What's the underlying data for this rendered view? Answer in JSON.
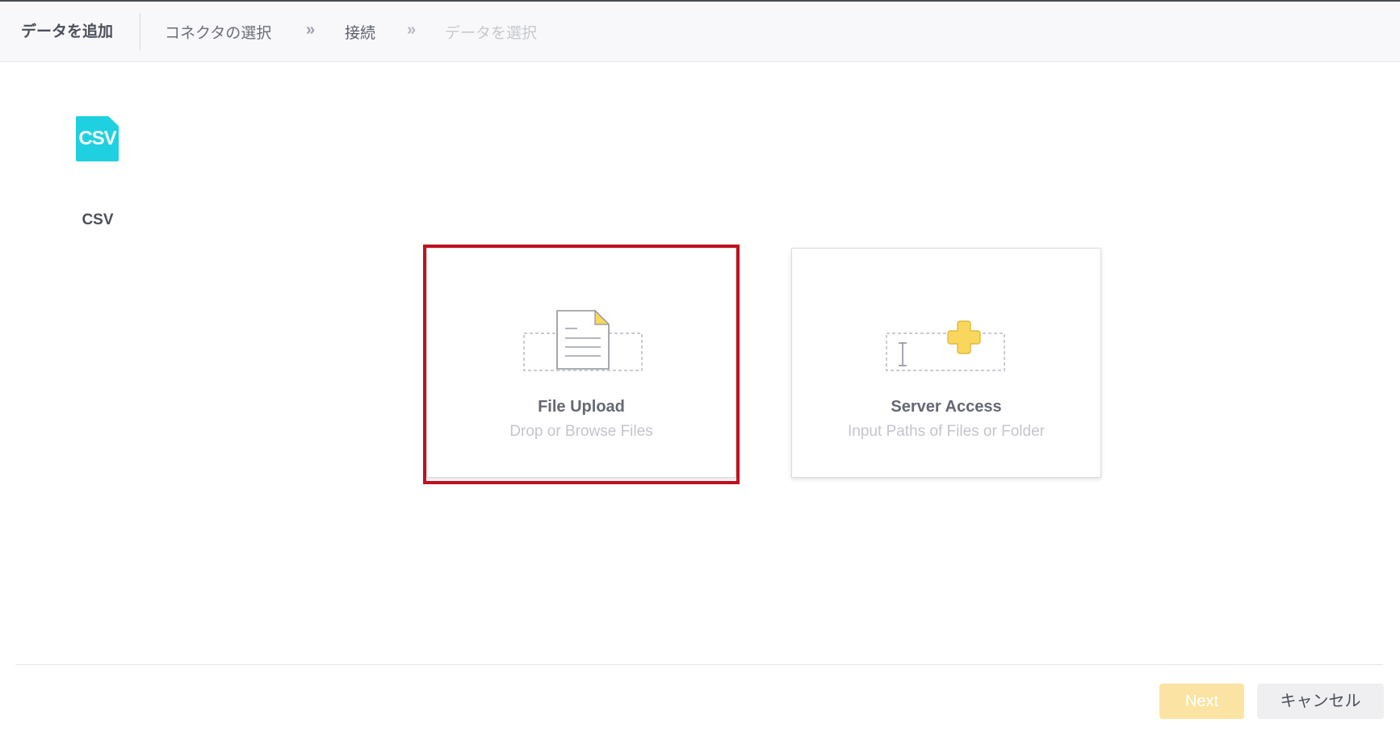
{
  "header": {
    "title": "データを追加",
    "steps": [
      "コネクタの選択",
      "接続",
      "データを選択"
    ],
    "separator": "»"
  },
  "connector": {
    "badge_text": "CSV",
    "label": "CSV",
    "badge_color": "#1fd0e0"
  },
  "options": [
    {
      "title": "File Upload",
      "subtitle": "Drop or Browse Files",
      "icon": "file-upload-icon",
      "selected": true
    },
    {
      "title": "Server Access",
      "subtitle": "Input Paths of Files or Folder",
      "icon": "server-access-icon",
      "selected": false
    }
  ],
  "footer": {
    "next_label": "Next",
    "cancel_label": "キャンセル"
  },
  "colors": {
    "selection": "#c0111f",
    "next_disabled": "#fbe4a3",
    "icon_accent": "#f9d75c"
  }
}
